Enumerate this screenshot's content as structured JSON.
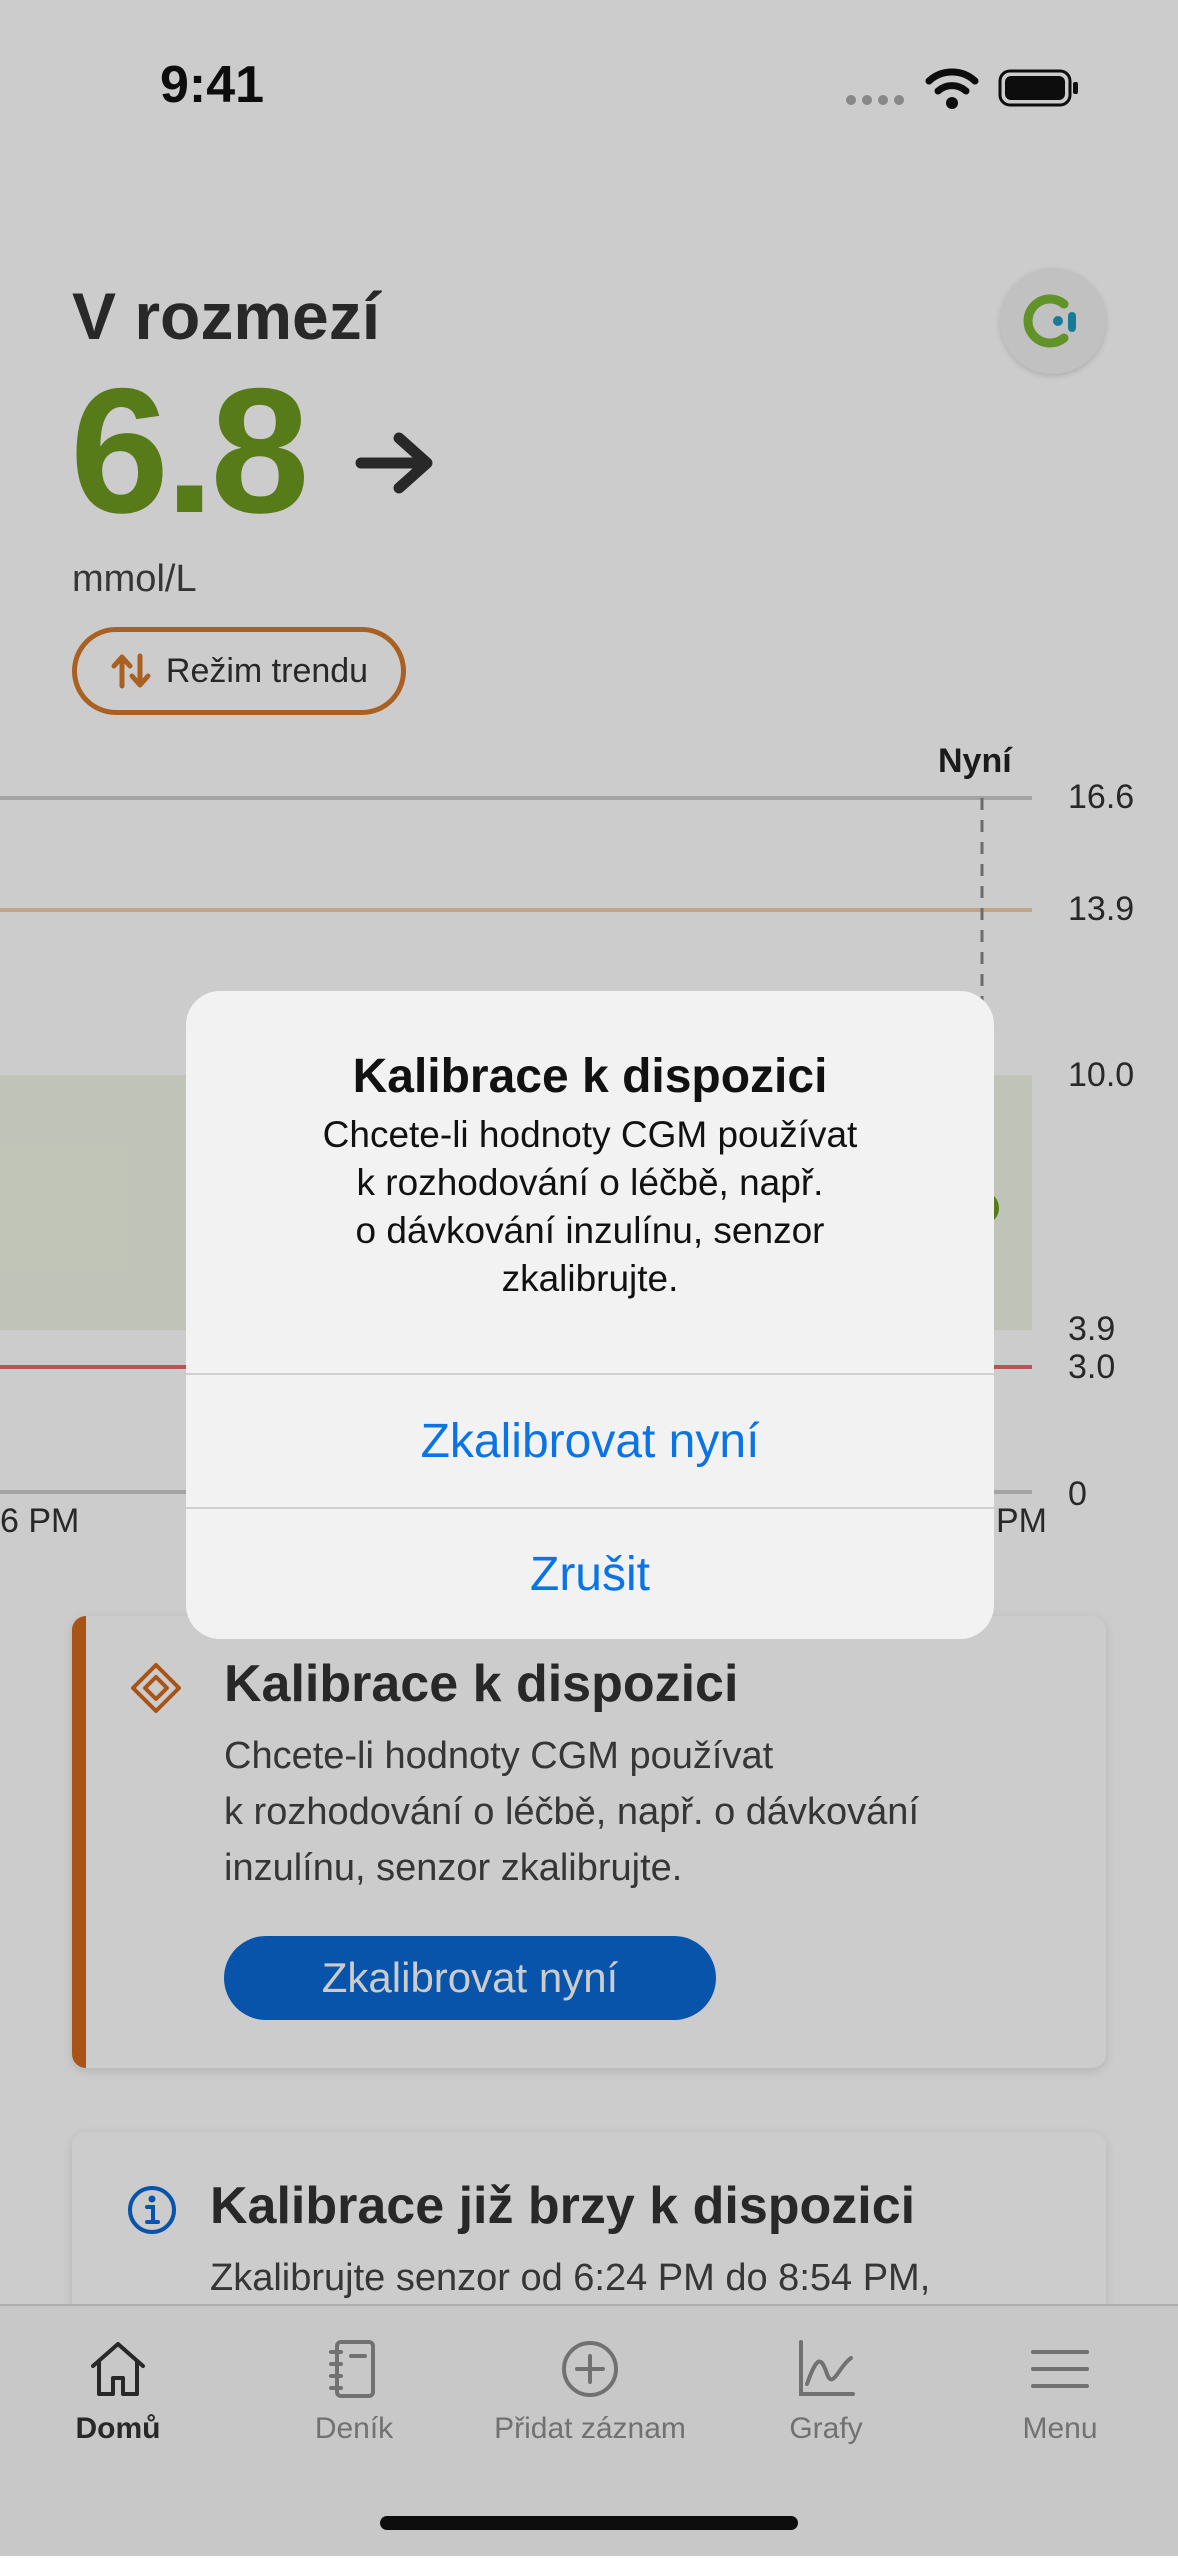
{
  "status_bar": {
    "time": "9:41"
  },
  "glucose": {
    "range_label": "V rozmezí",
    "value": "6.8",
    "unit": "mmol/L",
    "trend_mode_label": "Režim trendu"
  },
  "chart": {
    "now_label": "Nyní",
    "y_ticks": [
      "16.6",
      "13.9",
      "10.0",
      "3.9",
      "3.0",
      "0"
    ],
    "time_left": "6 PM",
    "time_right": "PM"
  },
  "cards": [
    {
      "title": "Kalibrace k dispozici",
      "text_lines": [
        "Chcete-li hodnoty CGM používat",
        "k rozhodování o léčbě, např. o dávkování",
        "inzulínu, senzor zkalibrujte."
      ],
      "button_label": "Zkalibrovat nyní"
    },
    {
      "title": "Kalibrace již brzy k dispozici",
      "text": "Zkalibrujte senzor od 6:24 PM do 8:54 PM,"
    }
  ],
  "tabs": [
    {
      "label": "Domů"
    },
    {
      "label": "Deník"
    },
    {
      "label": "Přidat záznam"
    },
    {
      "label": "Grafy"
    },
    {
      "label": "Menu"
    }
  ],
  "alert": {
    "title": "Kalibrace k dispozici",
    "message_lines": [
      "Chcete-li hodnoty CGM používat",
      "k rozhodování o léčbě, např.",
      "o dávkování inzulínu, senzor",
      "zkalibrujte."
    ],
    "primary_button": "Zkalibrovat nyní",
    "cancel_button": "Zrušit"
  },
  "colors": {
    "in_range_green": "#6c9a1f",
    "accent_orange": "#d26a1c",
    "primary_blue": "#0a6ad6",
    "alert_link_blue": "#0a74e6",
    "low_red": "#d23a3a"
  }
}
